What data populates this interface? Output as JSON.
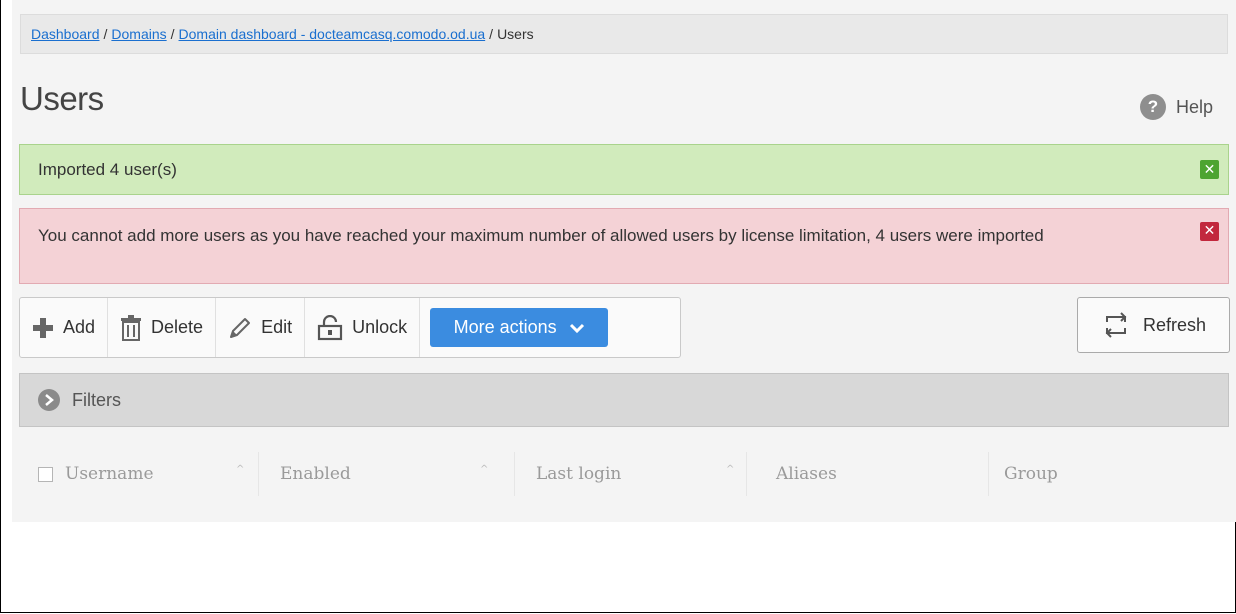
{
  "breadcrumb": {
    "items": [
      "Dashboard",
      "Domains",
      "Domain dashboard - docteamcasq.comodo.od.ua"
    ],
    "current": "Users",
    "separator": "/"
  },
  "page": {
    "title": "Users",
    "help_label": "Help"
  },
  "alerts": {
    "success": "Imported 4 user(s)",
    "error": "You cannot add more users as you have reached your maximum number of allowed users by license limitation, 4 users were imported"
  },
  "toolbar": {
    "add_label": "Add",
    "delete_label": "Delete",
    "edit_label": "Edit",
    "unlock_label": "Unlock",
    "more_actions_label": "More actions",
    "refresh_label": "Refresh"
  },
  "filters": {
    "label": "Filters"
  },
  "table": {
    "columns": [
      "Username",
      "Enabled",
      "Last login",
      "Aliases",
      "Group"
    ]
  },
  "colors": {
    "accent": "#3b8ce0",
    "success_bg": "#d1ebbc",
    "error_bg": "#f4d2d6",
    "link": "#1a6fcf"
  },
  "icons": {
    "add": "plus-icon",
    "delete": "trash-icon",
    "edit": "pencil-icon",
    "unlock": "unlock-icon",
    "more": "chevron-down-icon",
    "refresh": "refresh-icon",
    "help": "question-icon",
    "filters": "chevron-right-icon",
    "close": "close-icon"
  }
}
